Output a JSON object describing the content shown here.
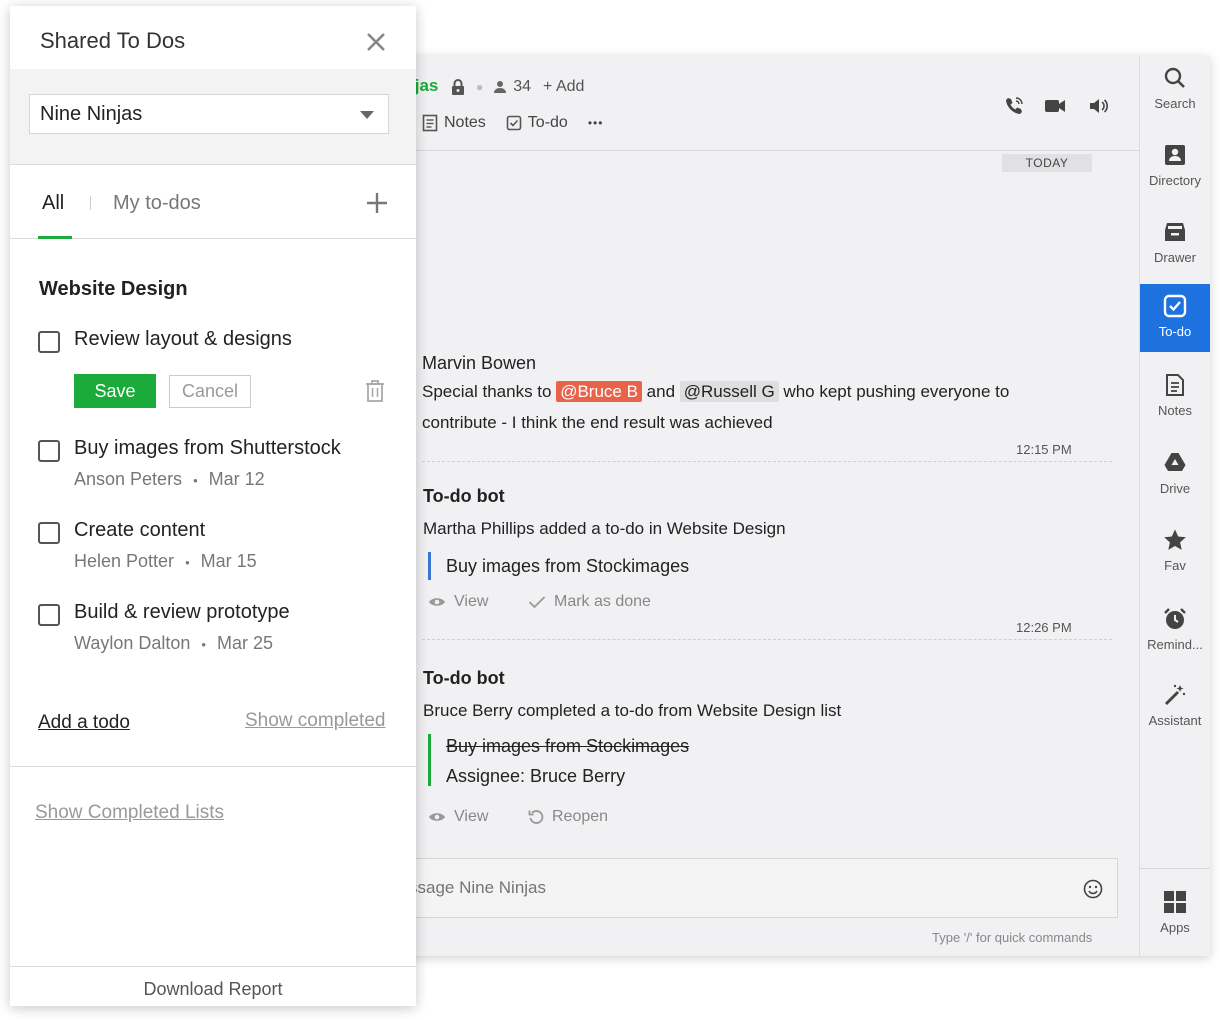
{
  "chat": {
    "channel_fragment": "ijas",
    "members": "34",
    "add": "+ Add",
    "tab_notes": "Notes",
    "tab_todo": "To-do",
    "more": "•••",
    "today": "TODAY",
    "messages": [
      {
        "author": "Marvin Bowen",
        "text_before": "Special thanks to ",
        "mention1": "@Bruce B",
        "text_mid": " and ",
        "mention2": "@Russell G",
        "text_after": " who kept pushing everyone to",
        "line2": "contribute - I think the end result was achieved",
        "time": "12:15 PM"
      },
      {
        "author": "To-do bot",
        "text": "Martha Phillips added a to-do in Website Design",
        "quote": "Buy images from Stockimages",
        "action1": "View",
        "action2": "Mark as done",
        "time": "12:26 PM"
      },
      {
        "author": "To-do bot",
        "text": "Bruce Berry completed a to-do from Website Design list",
        "quote": "Buy images from Stockimages",
        "assignee": "Assignee: Bruce Berry",
        "action1": "View",
        "action2": "Reopen"
      }
    ],
    "composer_placeholder": "ssage Nine Ninjas",
    "hint": "Type '/' for quick commands"
  },
  "rail": {
    "items": [
      {
        "label": "Search",
        "icon": "search-icon"
      },
      {
        "label": "Directory",
        "icon": "directory-icon"
      },
      {
        "label": "Drawer",
        "icon": "drawer-icon"
      },
      {
        "label": "To-do",
        "icon": "todo-icon"
      },
      {
        "label": "Notes",
        "icon": "notes-icon"
      },
      {
        "label": "Drive",
        "icon": "drive-icon"
      },
      {
        "label": "Fav",
        "icon": "star-icon"
      },
      {
        "label": "Remind...",
        "icon": "alarm-icon"
      },
      {
        "label": "Assistant",
        "icon": "wand-icon"
      }
    ],
    "apps": "Apps",
    "active_color": "#1d72e0"
  },
  "panel": {
    "title": "Shared To Dos",
    "select_value": "Nine Ninjas",
    "tab_all": "All",
    "tab_mine": "My to-dos",
    "section": "Website Design",
    "todos": [
      {
        "title": "Review layout & designs"
      },
      {
        "title": "Buy images from Shutterstock",
        "assignee": "Anson Peters",
        "date": "Mar 12"
      },
      {
        "title": "Create content",
        "assignee": "Helen Potter",
        "date": "Mar 15"
      },
      {
        "title": "Build & review prototype",
        "assignee": "Waylon Dalton",
        "date": "Mar 25"
      }
    ],
    "bullet": "•",
    "save": "Save",
    "cancel": "Cancel",
    "add_todo": "Add a todo",
    "show_completed": "Show completed",
    "show_completed_lists": "Show Completed Lists",
    "download": "Download Report",
    "accent": "#1aab3a"
  }
}
